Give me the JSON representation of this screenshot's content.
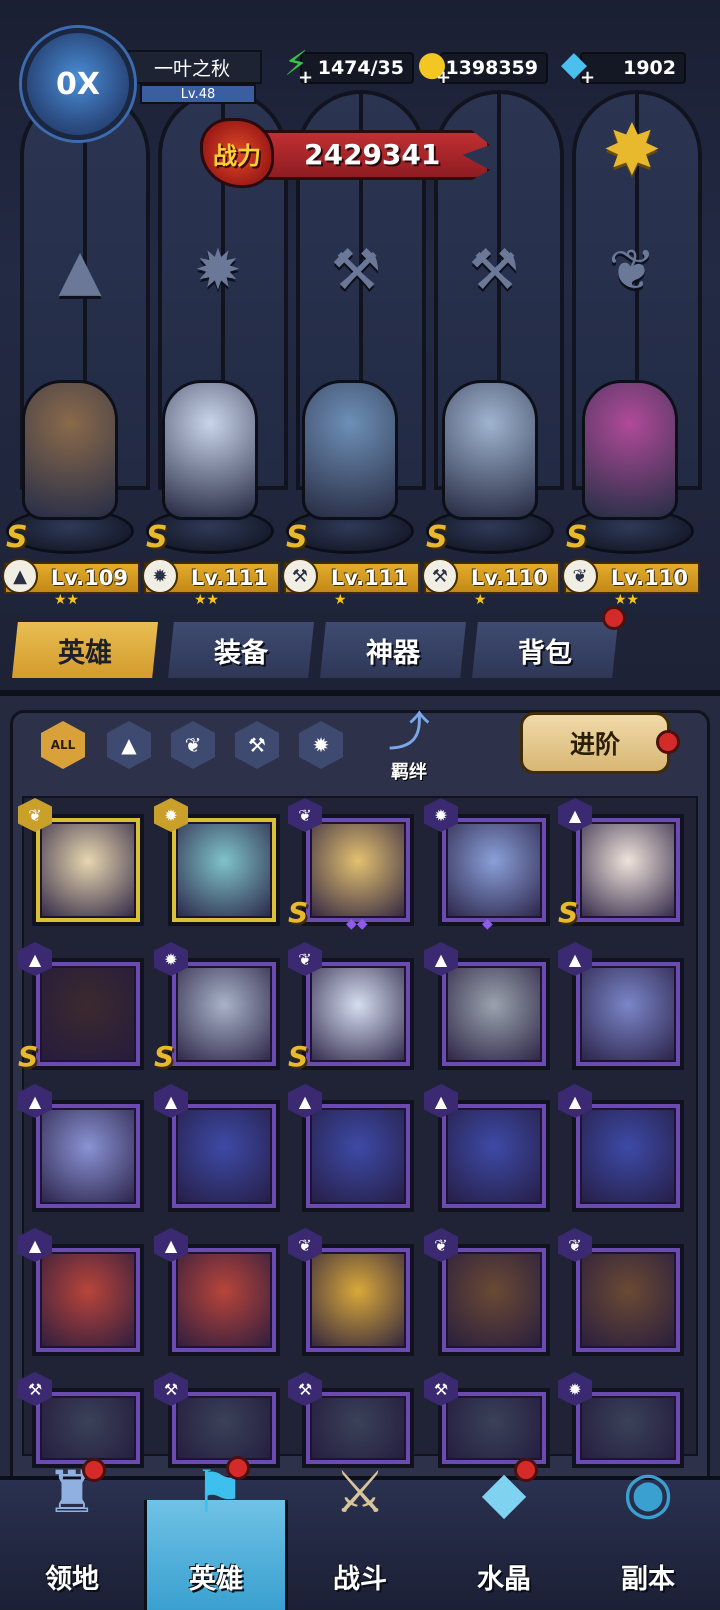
{
  "player": {
    "avatar_text": "0X",
    "name": "一叶之秋",
    "level": "Lv.48"
  },
  "resources": {
    "stamina": "1474/35",
    "gold": "1398359",
    "gems": "1902"
  },
  "power": {
    "label": "战力",
    "value": "2429341"
  },
  "lineup": [
    {
      "rank": "S",
      "level": "Lv.109",
      "class_icon": "hat-icon",
      "stars": "★★",
      "color": "#8a6a4a"
    },
    {
      "rank": "S",
      "level": "Lv.111",
      "class_icon": "monster-icon",
      "stars": "★★",
      "color": "#c9d4ea"
    },
    {
      "rank": "S",
      "level": "Lv.111",
      "class_icon": "wrench-icon",
      "stars": "★",
      "color": "#6d8fb6"
    },
    {
      "rank": "S",
      "level": "Lv.110",
      "class_icon": "wrench-icon",
      "stars": "★",
      "color": "#9fb3cf"
    },
    {
      "rank": "S",
      "level": "Lv.110",
      "class_icon": "wing-icon",
      "stars": "★★",
      "color": "#b04a9a"
    }
  ],
  "tabs": [
    {
      "label": "英雄",
      "active": true
    },
    {
      "label": "装备",
      "active": false
    },
    {
      "label": "神器",
      "active": false
    },
    {
      "label": "背包",
      "active": false
    }
  ],
  "filters": {
    "all_label": "ALL",
    "bond_label": "羁绊",
    "advance_label": "进阶"
  },
  "hero_cards": [
    {
      "frame": "gold",
      "class": "wing",
      "rank": "",
      "stars": "",
      "color": "#e7d7b0"
    },
    {
      "frame": "gold",
      "class": "monster",
      "rank": "",
      "stars": "",
      "color": "#7fc3c9"
    },
    {
      "frame": "purple",
      "class": "wing",
      "rank": "S",
      "stars": "◆◆",
      "color": "#e3c170"
    },
    {
      "frame": "purple",
      "class": "monster",
      "rank": "",
      "stars": "◆",
      "color": "#8aa0d8"
    },
    {
      "frame": "purple",
      "class": "hat",
      "rank": "S",
      "stars": "",
      "color": "#efe3da"
    },
    {
      "frame": "purple",
      "class": "hat",
      "rank": "S",
      "stars": "",
      "color": "#3b2a2e"
    },
    {
      "frame": "purple",
      "class": "monster",
      "rank": "S",
      "stars": "",
      "color": "#a8b3c8"
    },
    {
      "frame": "purple",
      "class": "wing",
      "rank": "S",
      "stars": "",
      "color": "#d5def0"
    },
    {
      "frame": "purple",
      "class": "hat",
      "rank": "",
      "stars": "",
      "color": "#9aa3ad"
    },
    {
      "frame": "purple",
      "class": "hat",
      "rank": "",
      "stars": "",
      "color": "#7b86c8"
    },
    {
      "frame": "purple",
      "class": "hat",
      "rank": "",
      "stars": "",
      "color": "#8a93d4"
    },
    {
      "frame": "purple",
      "class": "hat",
      "rank": "",
      "stars": "",
      "color": "#3d4aa6"
    },
    {
      "frame": "purple",
      "class": "hat",
      "rank": "",
      "stars": "",
      "color": "#3d4aa6"
    },
    {
      "frame": "purple",
      "class": "hat",
      "rank": "",
      "stars": "",
      "color": "#3d4aa6"
    },
    {
      "frame": "purple",
      "class": "hat",
      "rank": "",
      "stars": "",
      "color": "#3d4aa6"
    },
    {
      "frame": "purple",
      "class": "hat",
      "rank": "",
      "stars": "",
      "color": "#b8453a"
    },
    {
      "frame": "purple",
      "class": "hat",
      "rank": "",
      "stars": "",
      "color": "#b8453a"
    },
    {
      "frame": "purple",
      "class": "wing",
      "rank": "",
      "stars": "",
      "color": "#d9a93a"
    },
    {
      "frame": "purple",
      "class": "wing",
      "rank": "",
      "stars": "",
      "color": "#6a4a34"
    },
    {
      "frame": "purple",
      "class": "wing",
      "rank": "",
      "stars": "",
      "color": "#6a4a34"
    },
    {
      "frame": "purple",
      "class": "wrench",
      "rank": "",
      "stars": "",
      "color": "#3a4258"
    },
    {
      "frame": "purple",
      "class": "wrench",
      "rank": "",
      "stars": "",
      "color": "#3a4258"
    },
    {
      "frame": "purple",
      "class": "wrench",
      "rank": "",
      "stars": "",
      "color": "#3a4258"
    },
    {
      "frame": "purple",
      "class": "wrench",
      "rank": "",
      "stars": "",
      "color": "#3a4258"
    },
    {
      "frame": "purple",
      "class": "monster",
      "rank": "",
      "stars": "",
      "color": "#3a4258"
    }
  ],
  "bottom_nav": [
    {
      "label": "领地",
      "icon": "castle-icon",
      "active": false,
      "badge": true
    },
    {
      "label": "英雄",
      "icon": "hero-icon",
      "active": true,
      "badge": true
    },
    {
      "label": "战斗",
      "icon": "battle-icon",
      "active": false,
      "badge": false
    },
    {
      "label": "水晶",
      "icon": "crystal-icon",
      "active": false,
      "badge": true
    },
    {
      "label": "副本",
      "icon": "dungeon-icon",
      "active": false,
      "badge": false
    }
  ],
  "colors": {
    "accent_gold": "#e9b92d",
    "power_red": "#c02f32",
    "card_purple": "#6b4bb2",
    "badge_red": "#d42a2a"
  }
}
